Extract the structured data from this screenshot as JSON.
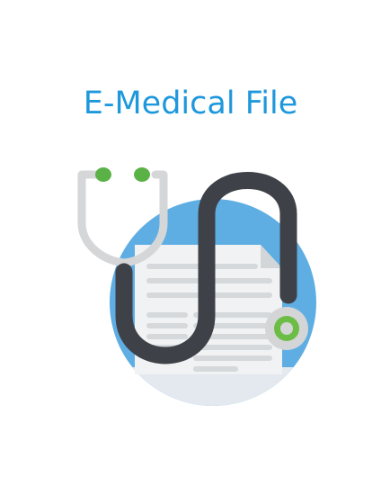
{
  "app": {
    "title": "E-Medical File"
  },
  "logo": {
    "icon": "medical-file-stethoscope-icon",
    "colors": {
      "title": "#1e98dc",
      "circle": "#5faee3",
      "circle_bottom": "#e3e9ef",
      "paper": "#f1f2f3",
      "paper_fold": "#d3d6d9",
      "lines": "#d6d9dc",
      "tube": "#3e4147",
      "earpiece_frame": "#d5d6d8",
      "earpiece_tip": "#5ab246",
      "chest_piece_ring": "#d3d5d7",
      "chest_piece_center": "#6cbd45"
    }
  }
}
